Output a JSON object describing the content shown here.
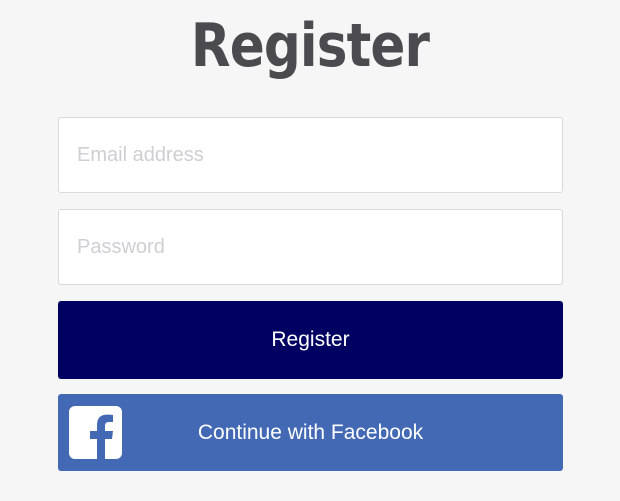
{
  "page": {
    "title": "Register"
  },
  "form": {
    "email": {
      "value": "",
      "placeholder": "Email address"
    },
    "password": {
      "value": "",
      "placeholder": "Password"
    },
    "register_button": {
      "label": "Register",
      "color": "#000062"
    },
    "facebook_button": {
      "label": "Continue with Facebook",
      "icon": "facebook-icon",
      "color": "#4369b5"
    }
  },
  "colors": {
    "background": "#f6f6f6",
    "title": "#4a4a4f"
  }
}
